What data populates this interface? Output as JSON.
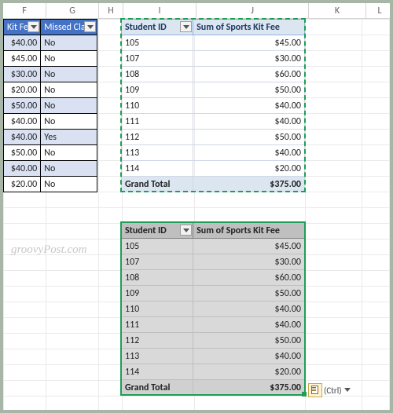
{
  "columns": [
    "F",
    "G",
    "H",
    "I",
    "J",
    "K",
    "L"
  ],
  "left_table": {
    "headers": [
      "Kit Fee",
      "Missed Class"
    ],
    "rows": [
      {
        "fee": "$40.00",
        "missed": "No"
      },
      {
        "fee": "$45.00",
        "missed": "No"
      },
      {
        "fee": "$30.00",
        "missed": "No"
      },
      {
        "fee": "$20.00",
        "missed": "No"
      },
      {
        "fee": "$50.00",
        "missed": "No"
      },
      {
        "fee": "$40.00",
        "missed": "No"
      },
      {
        "fee": "$40.00",
        "missed": "Yes"
      },
      {
        "fee": "$50.00",
        "missed": "No"
      },
      {
        "fee": "$40.00",
        "missed": "No"
      },
      {
        "fee": "$20.00",
        "missed": "No"
      }
    ]
  },
  "pivot": {
    "headers": [
      "Student ID",
      "Sum of Sports Kit Fee"
    ],
    "rows": [
      {
        "id": "105",
        "sum": "$45.00"
      },
      {
        "id": "107",
        "sum": "$30.00"
      },
      {
        "id": "108",
        "sum": "$60.00"
      },
      {
        "id": "109",
        "sum": "$50.00"
      },
      {
        "id": "110",
        "sum": "$40.00"
      },
      {
        "id": "111",
        "sum": "$40.00"
      },
      {
        "id": "112",
        "sum": "$50.00"
      },
      {
        "id": "113",
        "sum": "$40.00"
      },
      {
        "id": "114",
        "sum": "$20.00"
      }
    ],
    "total_label": "Grand Total",
    "total_value": "$375.00"
  },
  "pasted": {
    "headers": [
      "Student ID",
      "Sum of Sports Kit Fee"
    ],
    "rows": [
      {
        "id": "105",
        "sum": "$45.00"
      },
      {
        "id": "107",
        "sum": "$30.00"
      },
      {
        "id": "108",
        "sum": "$60.00"
      },
      {
        "id": "109",
        "sum": "$50.00"
      },
      {
        "id": "110",
        "sum": "$40.00"
      },
      {
        "id": "111",
        "sum": "$40.00"
      },
      {
        "id": "112",
        "sum": "$50.00"
      },
      {
        "id": "113",
        "sum": "$40.00"
      },
      {
        "id": "114",
        "sum": "$20.00"
      }
    ],
    "total_label": "Grand Total",
    "total_value": "$375.00"
  },
  "smart_tag": {
    "label": "(Ctrl) "
  },
  "watermark": "groovyPost.com"
}
